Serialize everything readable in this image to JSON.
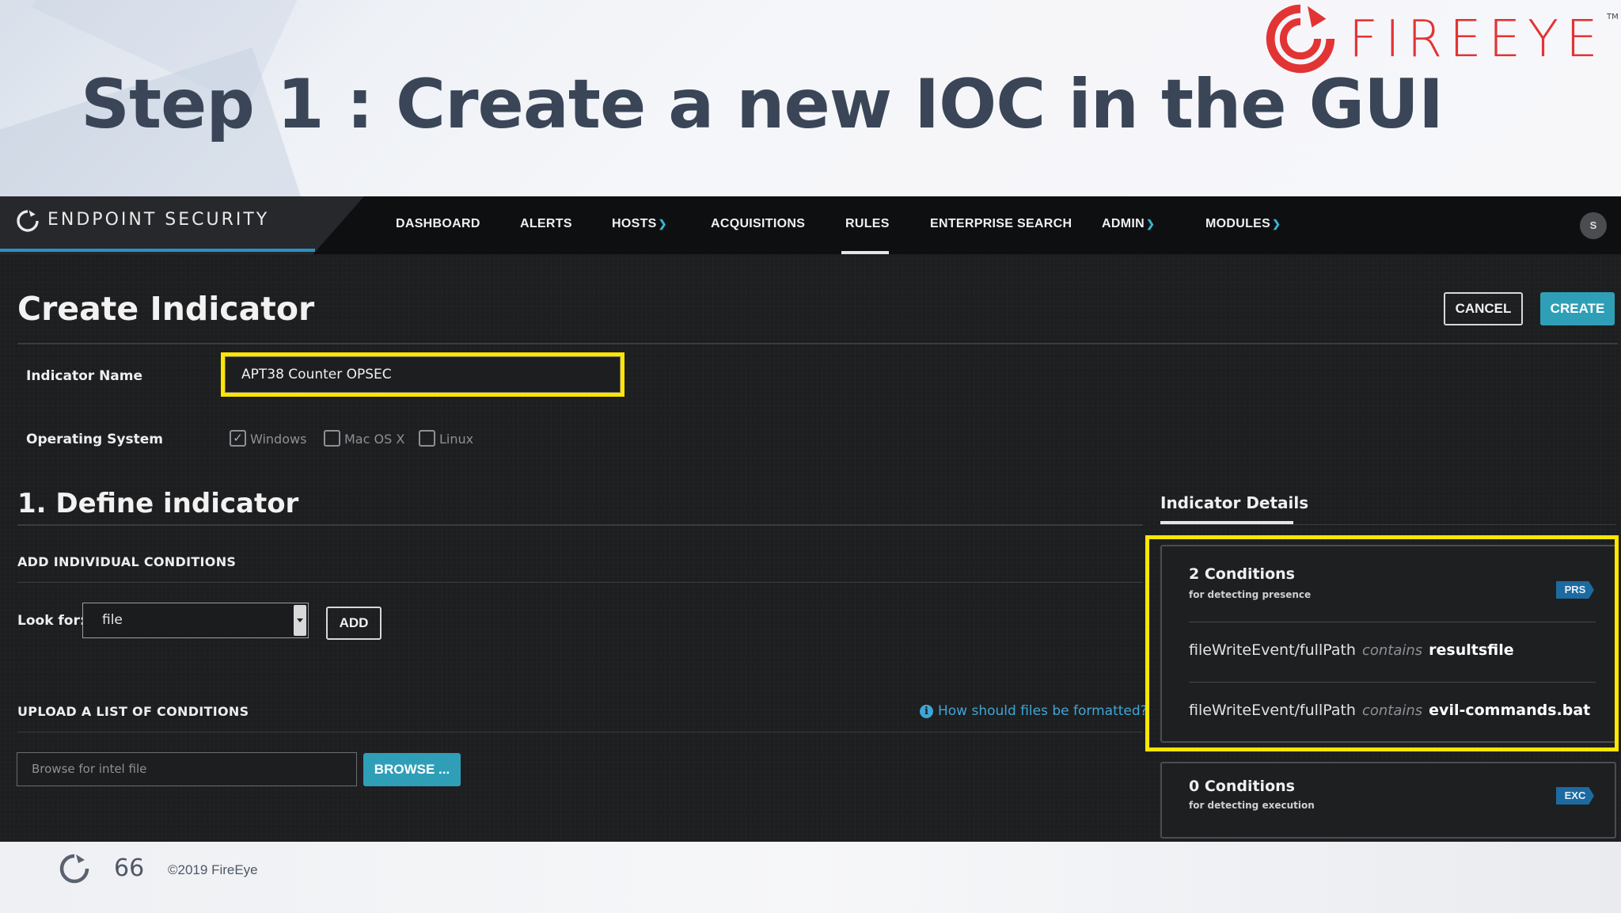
{
  "slide": {
    "title": "Step 1 : Create a new IOC in the GUI",
    "brand": "FIREEYE",
    "brand_tm": "TM",
    "page_number": "66",
    "copyright": "©2019 FireEye"
  },
  "app": {
    "name": "ENDPOINT SECURITY",
    "nav": [
      {
        "label": "DASHBOARD",
        "dropdown": false
      },
      {
        "label": "ALERTS",
        "dropdown": false
      },
      {
        "label": "HOSTS",
        "dropdown": true
      },
      {
        "label": "ACQUISITIONS",
        "dropdown": false
      },
      {
        "label": "RULES",
        "dropdown": false,
        "active": true
      },
      {
        "label": "ENTERPRISE SEARCH",
        "dropdown": false
      },
      {
        "label": "ADMIN",
        "dropdown": true
      },
      {
        "label": "MODULES",
        "dropdown": true
      }
    ],
    "user_initial": "S"
  },
  "page": {
    "title": "Create Indicator",
    "cancel_label": "CANCEL",
    "create_label": "CREATE",
    "indicator_name_label": "Indicator Name",
    "indicator_name_value": "APT38 Counter OPSEC",
    "os_label": "Operating System",
    "os_options": [
      {
        "label": "Windows",
        "checked": true
      },
      {
        "label": "Mac OS X",
        "checked": false
      },
      {
        "label": "Linux",
        "checked": false
      }
    ]
  },
  "define": {
    "title": "1. Define indicator",
    "add_conditions_label": "ADD INDIVIDUAL CONDITIONS",
    "look_for_label": "Look for:",
    "look_for_value": "file",
    "add_label": "ADD",
    "upload_label": "UPLOAD A LIST OF CONDITIONS",
    "help_link": "How should files be formatted?",
    "browse_placeholder": "Browse for intel file",
    "browse_label": "BROWSE ..."
  },
  "details": {
    "title": "Indicator Details",
    "presence": {
      "count": "2 Conditions",
      "subtitle": "for detecting presence",
      "tag": "PRS",
      "conditions": [
        {
          "field": "fileWriteEvent/fullPath",
          "operator": "contains",
          "value": "resultsfile"
        },
        {
          "field": "fileWriteEvent/fullPath",
          "operator": "contains",
          "value": "evil-commands.bat"
        }
      ]
    },
    "execution": {
      "count": "0 Conditions",
      "subtitle": "for detecting execution",
      "tag": "EXC"
    }
  },
  "colors": {
    "highlight": "#ffe600",
    "accent": "#2f9fb8",
    "brand_red": "#e23434",
    "link": "#3fa6d6"
  }
}
